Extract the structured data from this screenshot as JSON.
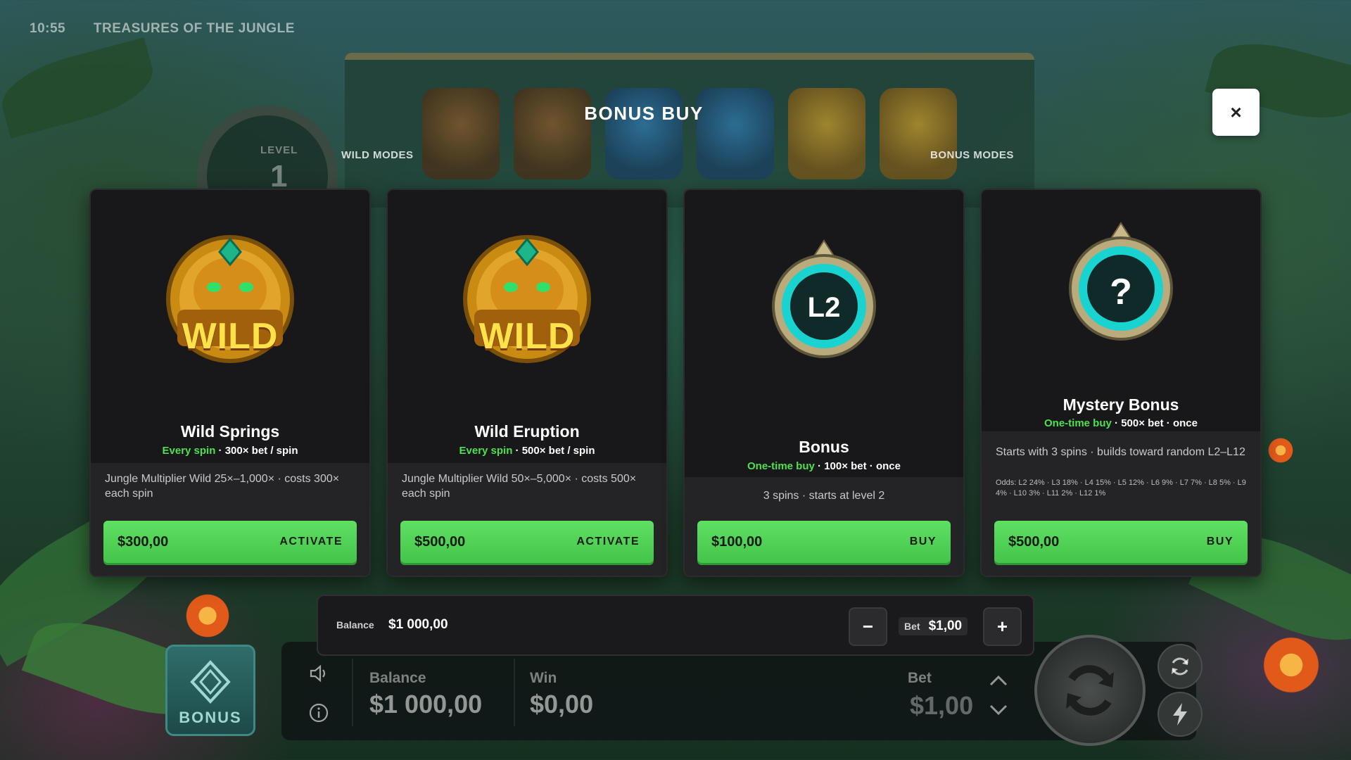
{
  "status": {
    "time": "10:55",
    "game_title": "TREASURES OF THE JUNGLE"
  },
  "background": {
    "level_label": "LEVEL",
    "level_value": "1"
  },
  "dialog": {
    "title": "BONUS BUY",
    "left_section": "WILD MODES",
    "right_section": "BONUS MODES",
    "close_label": "×"
  },
  "cards": [
    {
      "emblem": "wild-jaguar-emblem",
      "emblem_text": "WILD",
      "name": "Wild Springs",
      "sub_highlight": "Every spin",
      "sub_rest": " · 300× bet / spin",
      "desc": "Jungle Multiplier Wild 25×–1,000× · costs 300× each spin",
      "price": "$300,00",
      "action": "ACTIVATE"
    },
    {
      "emblem": "wild-jaguar-emblem",
      "emblem_text": "WILD",
      "name": "Wild Eruption",
      "sub_highlight": "Every spin",
      "sub_rest": " · 500× bet / spin",
      "desc": "Jungle Multiplier Wild 50×–5,000× · costs 500× each spin",
      "price": "$500,00",
      "action": "ACTIVATE"
    },
    {
      "emblem": "level-ring-emblem",
      "emblem_text": "L2",
      "name": "Bonus",
      "sub_highlight": "One-time buy",
      "sub_rest": " · 100× bet · once",
      "desc": "3 spins · starts at level 2",
      "price": "$100,00",
      "action": "BUY"
    },
    {
      "emblem": "mystery-ring-emblem",
      "emblem_text": "?",
      "name": "Mystery Bonus",
      "sub_highlight": "One-time buy",
      "sub_rest": " · 500× bet · once",
      "desc": "Starts with 3 spins · builds toward random L2–L12",
      "odds": "Odds: L2 24% · L3 18% · L4 15% · L5 12% · L6 9% · L7 7% · L8 5% · L9 4% · L10 3% · L11 2% · L12 1%",
      "price": "$500,00",
      "action": "BUY"
    }
  ],
  "bet_bar": {
    "balance_label": "Balance",
    "balance_value": "$1 000,00",
    "minus": "−",
    "plus": "+",
    "bet_label": "Bet",
    "bet_value": "$1,00"
  },
  "hud": {
    "balance_label": "Balance",
    "balance_value": "$1 000,00",
    "win_label": "Win",
    "win_value": "$0,00",
    "bet_label": "Bet",
    "bet_value": "$1,00",
    "bonus_label": "BONUS",
    "icons": [
      "speaker-icon",
      "info-icon",
      "chevron-up-icon",
      "chevron-down-icon",
      "spin-icon",
      "autoplay-icon",
      "turbo-icon"
    ]
  },
  "colors": {
    "accent_green": "#4fe04f",
    "button_green": "#5fe063",
    "card_bg": "#1b1b1d"
  }
}
